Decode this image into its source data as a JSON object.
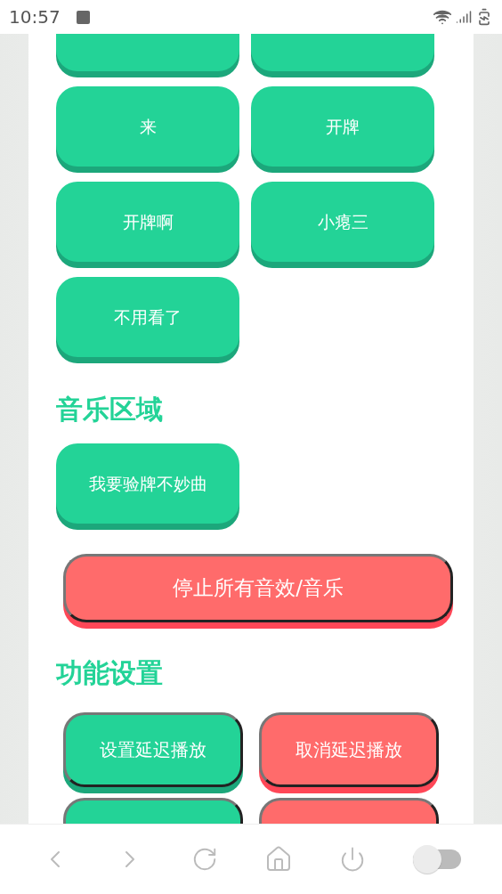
{
  "status_bar": {
    "time": "10:57"
  },
  "sound_buttons": [
    {
      "kind": "partial"
    },
    {
      "kind": "partial"
    },
    {
      "kind": "full",
      "label": "来"
    },
    {
      "kind": "full",
      "label": "开牌"
    },
    {
      "kind": "full",
      "label": "开牌啊"
    },
    {
      "kind": "full",
      "label": "小瘪三"
    },
    {
      "kind": "full",
      "label": "不用看了"
    }
  ],
  "music_section": {
    "title": "音乐区域",
    "buttons": [
      "我要验牌不妙曲"
    ]
  },
  "stop_button": "停止所有音效/音乐",
  "settings_section": {
    "title": "功能设置",
    "buttons": [
      {
        "label": "设置延迟播放",
        "kind": "green"
      },
      {
        "label": "取消延迟播放",
        "kind": "red"
      },
      {
        "kind": "green"
      },
      {
        "kind": "red"
      }
    ]
  },
  "bottom_bar": {
    "toggle": {
      "on": false
    }
  }
}
